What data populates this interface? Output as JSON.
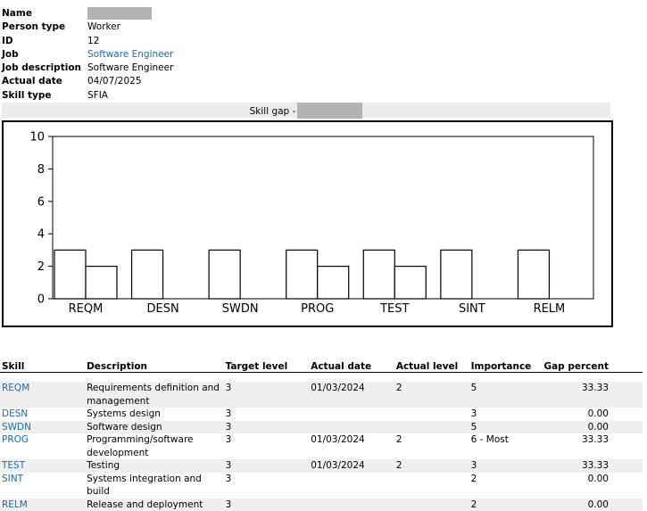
{
  "person": {
    "fields": [
      {
        "label": "Name",
        "value": "",
        "redacted": true
      },
      {
        "label": "Person type",
        "value": "Worker"
      },
      {
        "label": "ID",
        "value": "12"
      },
      {
        "label": "Job",
        "value": "Software Engineer",
        "link": true
      },
      {
        "label": "Job description",
        "value": "Software Engineer"
      },
      {
        "label": "Actual date",
        "value": "04/07/2025"
      },
      {
        "label": "Skill type",
        "value": "SFIA"
      }
    ]
  },
  "skill_gap_title": "Skill gap -",
  "chart_data": {
    "type": "bar",
    "categories": [
      "REQM",
      "DESN",
      "SWDN",
      "PROG",
      "TEST",
      "SINT",
      "RELM"
    ],
    "series": [
      {
        "values": [
          3,
          3,
          3,
          3,
          3,
          3,
          3
        ]
      },
      {
        "values": [
          2,
          0,
          0,
          2,
          2,
          0,
          0
        ]
      }
    ],
    "ylim": [
      0,
      10
    ],
    "yticks": [
      0,
      2,
      4,
      6,
      8,
      10
    ],
    "grid": false,
    "colors": {
      "bar_fill": "#ffffff",
      "bar_stroke": "#000000"
    }
  },
  "table": {
    "headers": [
      "Skill",
      "Description",
      "Target level",
      "Actual date",
      "Actual level",
      "Importance",
      "Gap percent"
    ],
    "rows": [
      {
        "skill": "REQM",
        "description": "Requirements definition and management",
        "target": "3",
        "date": "01/03/2024",
        "actual": "2",
        "importance": "5",
        "gap": "33.33"
      },
      {
        "skill": "DESN",
        "description": "Systems design",
        "target": "3",
        "date": "",
        "actual": "",
        "importance": "3",
        "gap": "0.00"
      },
      {
        "skill": "SWDN",
        "description": "Software design",
        "target": "3",
        "date": "",
        "actual": "",
        "importance": "5",
        "gap": "0.00"
      },
      {
        "skill": "PROG",
        "description": "Programming/software development",
        "target": "3",
        "date": "01/03/2024",
        "actual": "2",
        "importance": "6 - Most",
        "gap": "33.33"
      },
      {
        "skill": "TEST",
        "description": "Testing",
        "target": "3",
        "date": "01/03/2024",
        "actual": "2",
        "importance": "3",
        "gap": "33.33"
      },
      {
        "skill": "SINT",
        "description": "Systems integration and build",
        "target": "3",
        "date": "",
        "actual": "",
        "importance": "2",
        "gap": "0.00"
      },
      {
        "skill": "RELM",
        "description": "Release and deployment",
        "target": "3",
        "date": "",
        "actual": "",
        "importance": "2",
        "gap": "0.00"
      }
    ]
  }
}
